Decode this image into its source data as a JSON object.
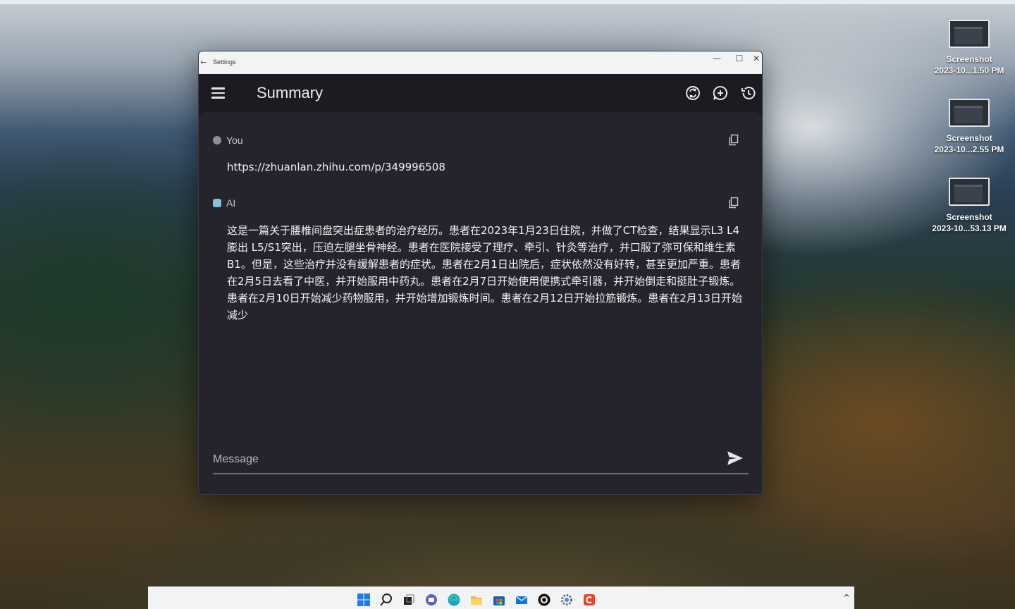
{
  "window": {
    "titlebar_title": "Settings",
    "back_glyph": "←",
    "minimize_glyph": "—",
    "maximize_glyph": "☐",
    "close_glyph": "✕"
  },
  "appbar": {
    "title": "Summary",
    "buttons": [
      "model-switch-icon",
      "new-chat-icon",
      "history-icon"
    ]
  },
  "messages": [
    {
      "sender": "You",
      "text": "https://zhuanlan.zhihu.com/p/349996508",
      "avatar_color": "#8a8f9a"
    },
    {
      "sender": "AI",
      "text": "这是一篇关于腰椎间盘突出症患者的治疗经历。患者在2023年1月23日住院，并做了CT检查，结果显示L3 L4膨出 L5/S1突出，压迫左腿坐骨神经。患者在医院接受了理疗、牵引、针灸等治疗，并口服了弥可保和维生素B1。但是，这些治疗并没有缓解患者的症状。患者在2月1日出院后，症状依然没有好转，甚至更加严重。患者在2月5日去看了中医，并开始服用中药丸。患者在2月7日开始使用便携式牵引器，并开始倒走和挺肚子锻炼。患者在2月10日开始减少药物服用，并开始增加锻炼时间。患者在2月12日开始拉筋锻炼。患者在2月13日开始减少",
      "avatar_color": "#7fc4d6"
    }
  ],
  "composer": {
    "placeholder": "Message",
    "value": ""
  },
  "desktop_icons": [
    {
      "line1": "Screenshot",
      "line2": "2023-10...1.50 PM"
    },
    {
      "line1": "Screenshot",
      "line2": "2023-10...2.55 PM"
    },
    {
      "line1": "Screenshot",
      "line2": "2023-10...53.13 PM"
    }
  ],
  "taskbar": {
    "icons": [
      "windows-start-icon",
      "search-icon",
      "task-view-icon",
      "chat-icon",
      "edge-icon",
      "file-explorer-icon",
      "store-icon",
      "mail-icon",
      "app-circle-icon",
      "settings-gear-icon",
      "app-red-icon"
    ],
    "tray_chevron": "^"
  },
  "colors": {
    "window_bg": "#1c1b22",
    "content_bg": "#25242c",
    "text": "#f1f1f4"
  }
}
